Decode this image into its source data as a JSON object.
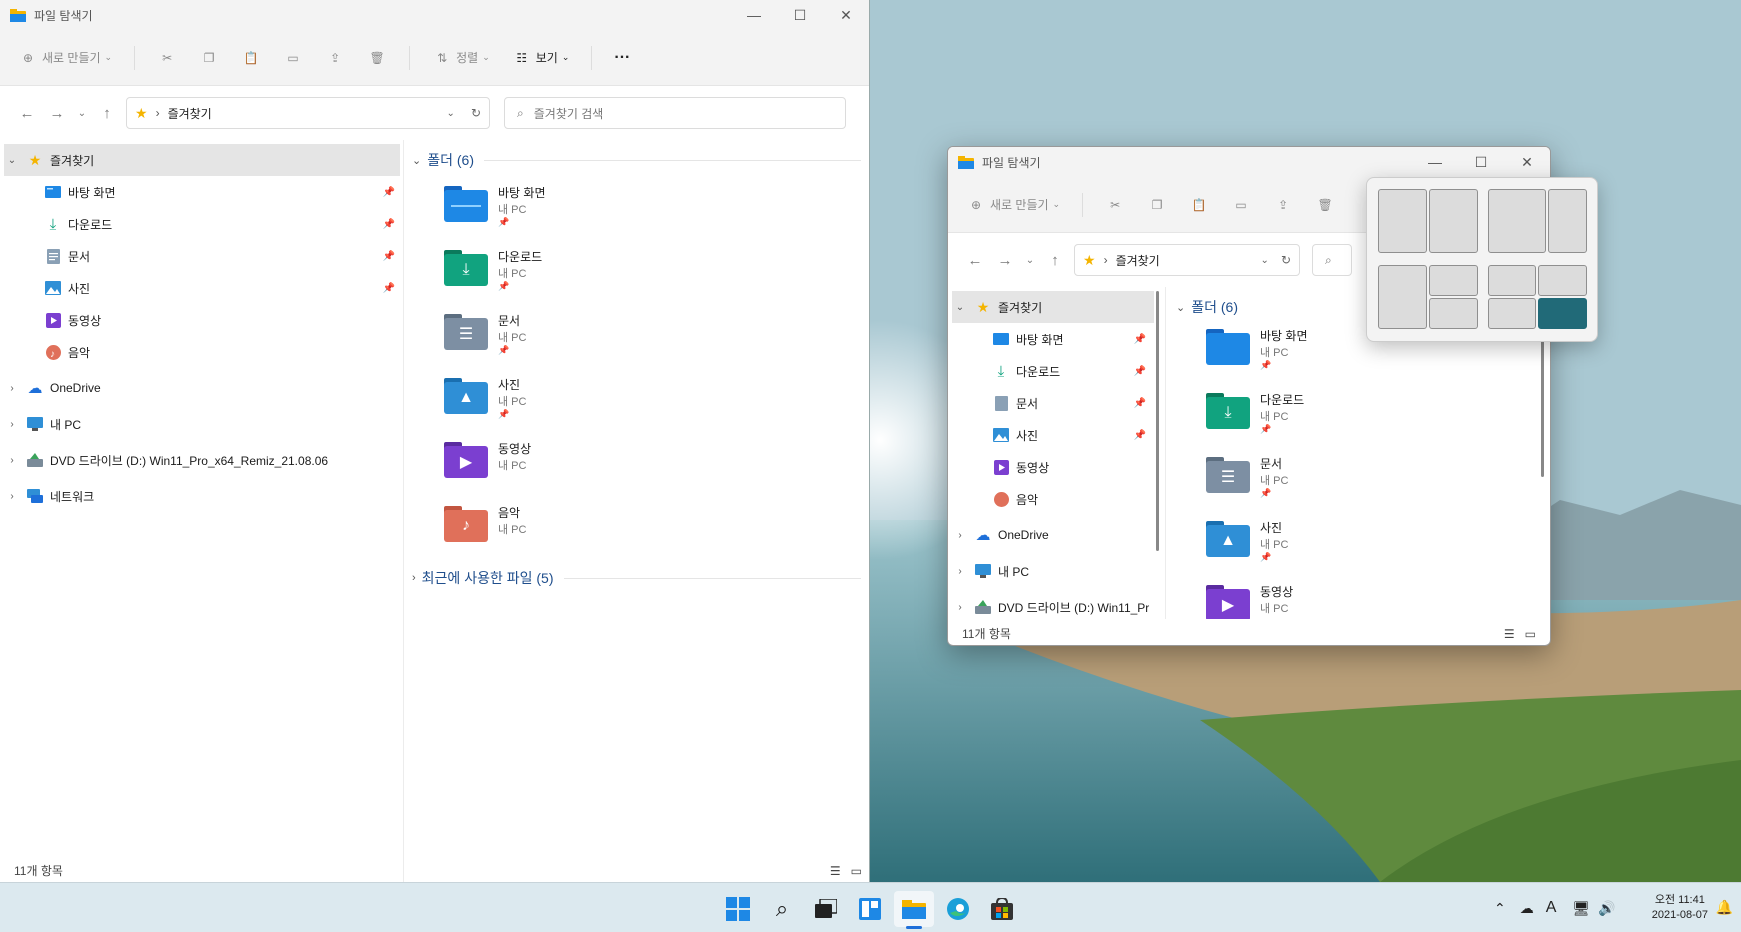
{
  "left_window": {
    "title": "파일 탐색기",
    "toolbar": {
      "new_label": "새로 만들기",
      "sort_label": "정렬",
      "view_label": "보기",
      "more": "···"
    },
    "address": {
      "path_label": "즐겨찾기",
      "search_placeholder": "즐겨찾기 검색"
    },
    "nav": {
      "favorites": "즐겨찾기",
      "items": [
        {
          "label": "바탕 화면"
        },
        {
          "label": "다운로드"
        },
        {
          "label": "문서"
        },
        {
          "label": "사진"
        },
        {
          "label": "동영상"
        },
        {
          "label": "음악"
        }
      ],
      "onedrive": "OneDrive",
      "mypc": "내 PC",
      "dvd": "DVD 드라이브 (D:) Win11_Pro_x64_Remiz_21.08.06",
      "network": "네트워크"
    },
    "content": {
      "folders_header": "폴더 (6)",
      "folders": [
        {
          "name": "바탕 화면",
          "sub": "내 PC"
        },
        {
          "name": "다운로드",
          "sub": "내 PC"
        },
        {
          "name": "문서",
          "sub": "내 PC"
        },
        {
          "name": "사진",
          "sub": "내 PC"
        },
        {
          "name": "동영상",
          "sub": "내 PC"
        },
        {
          "name": "음악",
          "sub": "내 PC"
        }
      ],
      "recent_header": "최근에 사용한 파일 (5)"
    },
    "status": "11개 항목"
  },
  "right_window": {
    "title": "파일 탐색기",
    "toolbar": {
      "new_label": "새로 만들기"
    },
    "address": {
      "path_label": "즐겨찾기"
    },
    "nav": {
      "favorites": "즐겨찾기",
      "items": [
        {
          "label": "바탕 화면"
        },
        {
          "label": "다운로드"
        },
        {
          "label": "문서"
        },
        {
          "label": "사진"
        },
        {
          "label": "동영상"
        },
        {
          "label": "음악"
        }
      ],
      "onedrive": "OneDrive",
      "mypc": "내 PC",
      "dvd": "DVD 드라이브 (D:) Win11_Pr"
    },
    "content": {
      "folders_header": "폴더 (6)",
      "folders": [
        {
          "name": "바탕 화면",
          "sub": "내 PC"
        },
        {
          "name": "다운로드",
          "sub": "내 PC"
        },
        {
          "name": "문서",
          "sub": "내 PC"
        },
        {
          "name": "사진",
          "sub": "내 PC"
        },
        {
          "name": "동영상",
          "sub": "내 PC"
        }
      ]
    },
    "status": "11개 항목"
  },
  "taskbar": {
    "ime": "A",
    "clock_time": "오전 11:41",
    "clock_date": "2021-08-07"
  },
  "colors": {
    "accent": "#216a78",
    "folder_blue": "#1e88e5",
    "folder_teal": "#11a37f",
    "folder_gray": "#7d8fa3",
    "folder_sky": "#2f8fd6",
    "folder_purple": "#7b3fd0",
    "folder_orange": "#e0705a"
  }
}
